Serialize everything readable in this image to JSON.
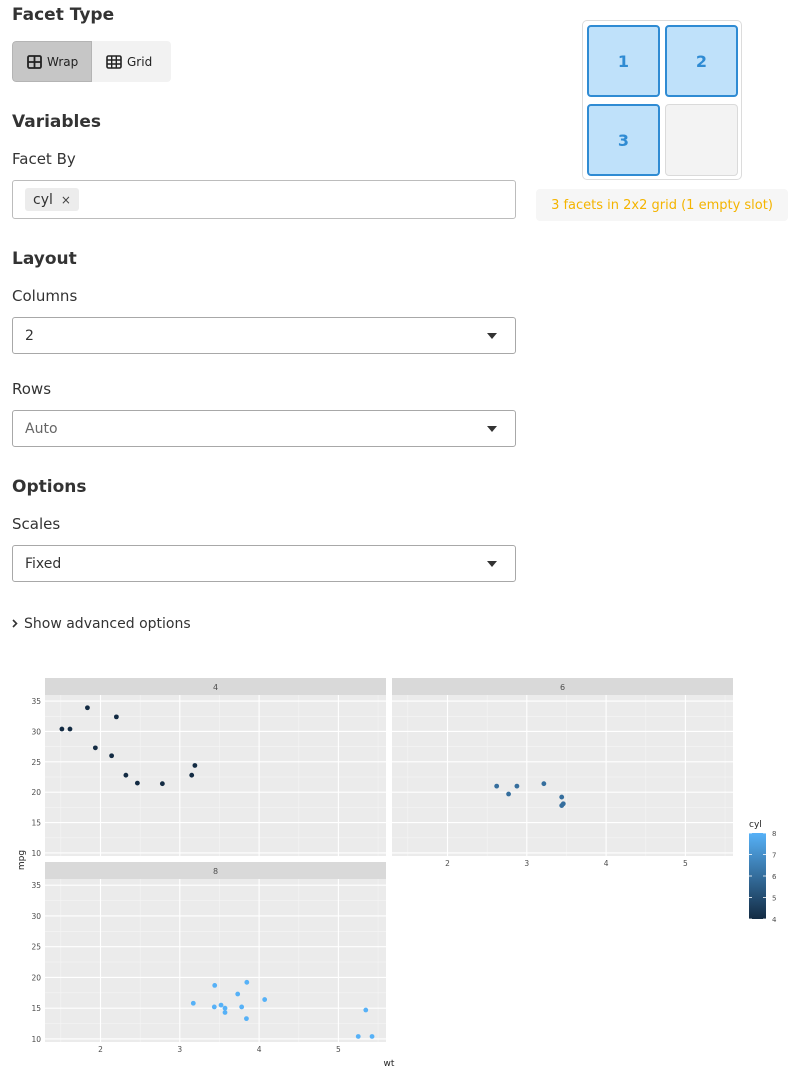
{
  "facet_type": {
    "heading": "Facet Type",
    "wrap_label": "Wrap",
    "grid_label": "Grid",
    "selected": "Wrap"
  },
  "variables": {
    "heading": "Variables",
    "facet_by_label": "Facet By",
    "facet_by_values": [
      "cyl"
    ],
    "remove_symbol": "×"
  },
  "layout": {
    "heading": "Layout",
    "columns_label": "Columns",
    "columns_value": "2",
    "rows_label": "Rows",
    "rows_value": "Auto"
  },
  "options": {
    "heading": "Options",
    "scales_label": "Scales",
    "scales_value": "Fixed",
    "advanced_toggle": "Show advanced options"
  },
  "preview": {
    "cells": [
      "1",
      "2",
      "3",
      ""
    ],
    "summary": "3 facets in 2x2 grid (1 empty slot)"
  },
  "colors": {
    "facet_fill": "#bfe1fa",
    "facet_border": "#2f8bd3",
    "summary_text": "#f4b400",
    "panel_bg": "#ebebeb",
    "strip_bg": "#d9d9d9",
    "cyl_low": "#132b43",
    "cyl_high": "#56b1f7"
  },
  "chart_data": {
    "type": "scatter",
    "facet_var": "cyl",
    "xlabel": "wt",
    "ylabel": "mpg",
    "xlim": [
      1.3,
      5.6
    ],
    "ylim": [
      9.5,
      36
    ],
    "x_ticks": [
      "2",
      "3",
      "4",
      "5"
    ],
    "y_ticks": [
      "10",
      "15",
      "20",
      "25",
      "30",
      "35"
    ],
    "legend": {
      "title": "cyl",
      "ticks": [
        "8",
        "7",
        "6",
        "5",
        "4"
      ],
      "position": "right"
    },
    "facets": [
      {
        "label": "4",
        "cyl": 4,
        "points": [
          [
            2.32,
            22.8
          ],
          [
            3.19,
            24.4
          ],
          [
            3.15,
            22.8
          ],
          [
            2.2,
            32.4
          ],
          [
            1.615,
            30.4
          ],
          [
            1.835,
            33.9
          ],
          [
            2.465,
            21.5
          ],
          [
            1.935,
            27.3
          ],
          [
            2.14,
            26.0
          ],
          [
            1.513,
            30.4
          ],
          [
            2.78,
            21.4
          ]
        ]
      },
      {
        "label": "6",
        "cyl": 6,
        "points": [
          [
            2.62,
            21.0
          ],
          [
            2.875,
            21.0
          ],
          [
            3.215,
            21.4
          ],
          [
            3.46,
            18.1
          ],
          [
            3.44,
            19.2
          ],
          [
            3.44,
            17.8
          ],
          [
            2.77,
            19.7
          ]
        ]
      },
      {
        "label": "8",
        "cyl": 8,
        "points": [
          [
            3.44,
            18.7
          ],
          [
            3.57,
            14.3
          ],
          [
            4.07,
            16.4
          ],
          [
            3.73,
            17.3
          ],
          [
            3.78,
            15.2
          ],
          [
            5.25,
            10.4
          ],
          [
            5.424,
            10.4
          ],
          [
            5.345,
            14.7
          ],
          [
            3.52,
            15.5
          ],
          [
            3.435,
            15.2
          ],
          [
            3.84,
            13.3
          ],
          [
            3.845,
            19.2
          ],
          [
            3.17,
            15.8
          ],
          [
            3.57,
            15.0
          ]
        ]
      }
    ]
  }
}
